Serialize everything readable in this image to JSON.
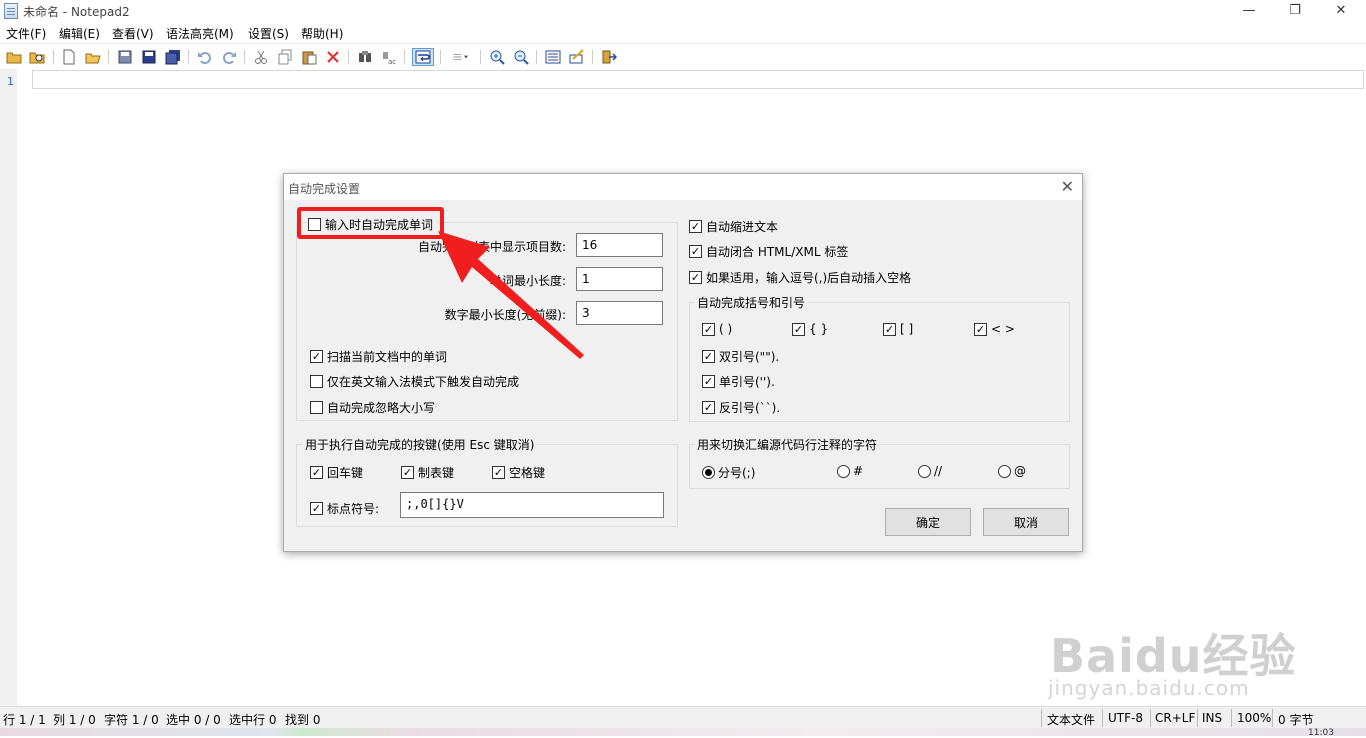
{
  "window": {
    "title": "未命名 - Notepad2",
    "minimize": "—",
    "restore": "❐",
    "close": "✕"
  },
  "menu": [
    "文件(F)",
    "编辑(E)",
    "查看(V)",
    "语法高亮(M)",
    "设置(S)",
    "帮助(H)"
  ],
  "editor": {
    "line_number": "1"
  },
  "status": {
    "line": "行 1 / 1",
    "col": "列 1 / 0",
    "chars": "字符 1 / 0",
    "sel": "选中 0 / 0",
    "sel_lines": "选中行 0",
    "found": "找到 0",
    "filetype": "文本文件",
    "encoding": "UTF-8",
    "eol": "CR+LF",
    "mode": "INS",
    "zoom": "100%",
    "bytes": "0 字节",
    "clock": "11:03"
  },
  "dialog": {
    "title": "自动完成设置",
    "close": "✕",
    "word_complete": {
      "label": "输入时自动完成单词",
      "checked": false
    },
    "list_count_label": "自动完成列表中显示项目数:",
    "list_count_value": "16",
    "word_min_label": "单词最小长度:",
    "word_min_value": "1",
    "num_min_label": "数字最小长度(无前缀):",
    "num_min_value": "3",
    "scan_doc": {
      "label": "扫描当前文档中的单词",
      "checked": true
    },
    "english_only": {
      "label": "仅在英文输入法模式下触发自动完成",
      "checked": false
    },
    "ignore_case": {
      "label": "自动完成忽略大小写",
      "checked": false
    },
    "indent": {
      "label": "自动缩进文本",
      "checked": true
    },
    "close_tags": {
      "label": "自动闭合 HTML/XML 标签",
      "checked": true
    },
    "comma_space": {
      "label": "如果适用，输入逗号(,)后自动插入空格",
      "checked": true
    },
    "brackets_group": "自动完成括号和引号",
    "brackets": [
      {
        "label": "( )",
        "checked": true
      },
      {
        "label": "{ }",
        "checked": true
      },
      {
        "label": "[ ]",
        "checked": true
      },
      {
        "label": "< >",
        "checked": true
      }
    ],
    "quotes": [
      {
        "label": "双引号(\"\").",
        "checked": true
      },
      {
        "label": "单引号('').",
        "checked": true
      },
      {
        "label": "反引号(``).",
        "checked": true
      }
    ],
    "keys_group": "用于执行自动完成的按键(使用 Esc 键取消)",
    "keys": [
      {
        "label": "回车键",
        "checked": true
      },
      {
        "label": "制表键",
        "checked": true
      },
      {
        "label": "空格键",
        "checked": true
      }
    ],
    "punct": {
      "label": "标点符号:",
      "checked": true,
      "value": ";,()[]{}\\'\"/?<>"
    },
    "punct_display": ";,0[]{}V",
    "comment_group": "用来切换汇编源代码行注释的字符",
    "comment_opts": [
      {
        "label": "分号(;)",
        "selected": true
      },
      {
        "label": "#",
        "selected": false
      },
      {
        "label": "//",
        "selected": false
      },
      {
        "label": "@",
        "selected": false
      }
    ],
    "ok": "确定",
    "cancel": "取消"
  },
  "watermark": {
    "brand": "Baidu经验",
    "url": "jingyan.baidu.com"
  },
  "colors": {
    "highlight": "#f01e1e",
    "accent": "#0078d7"
  }
}
